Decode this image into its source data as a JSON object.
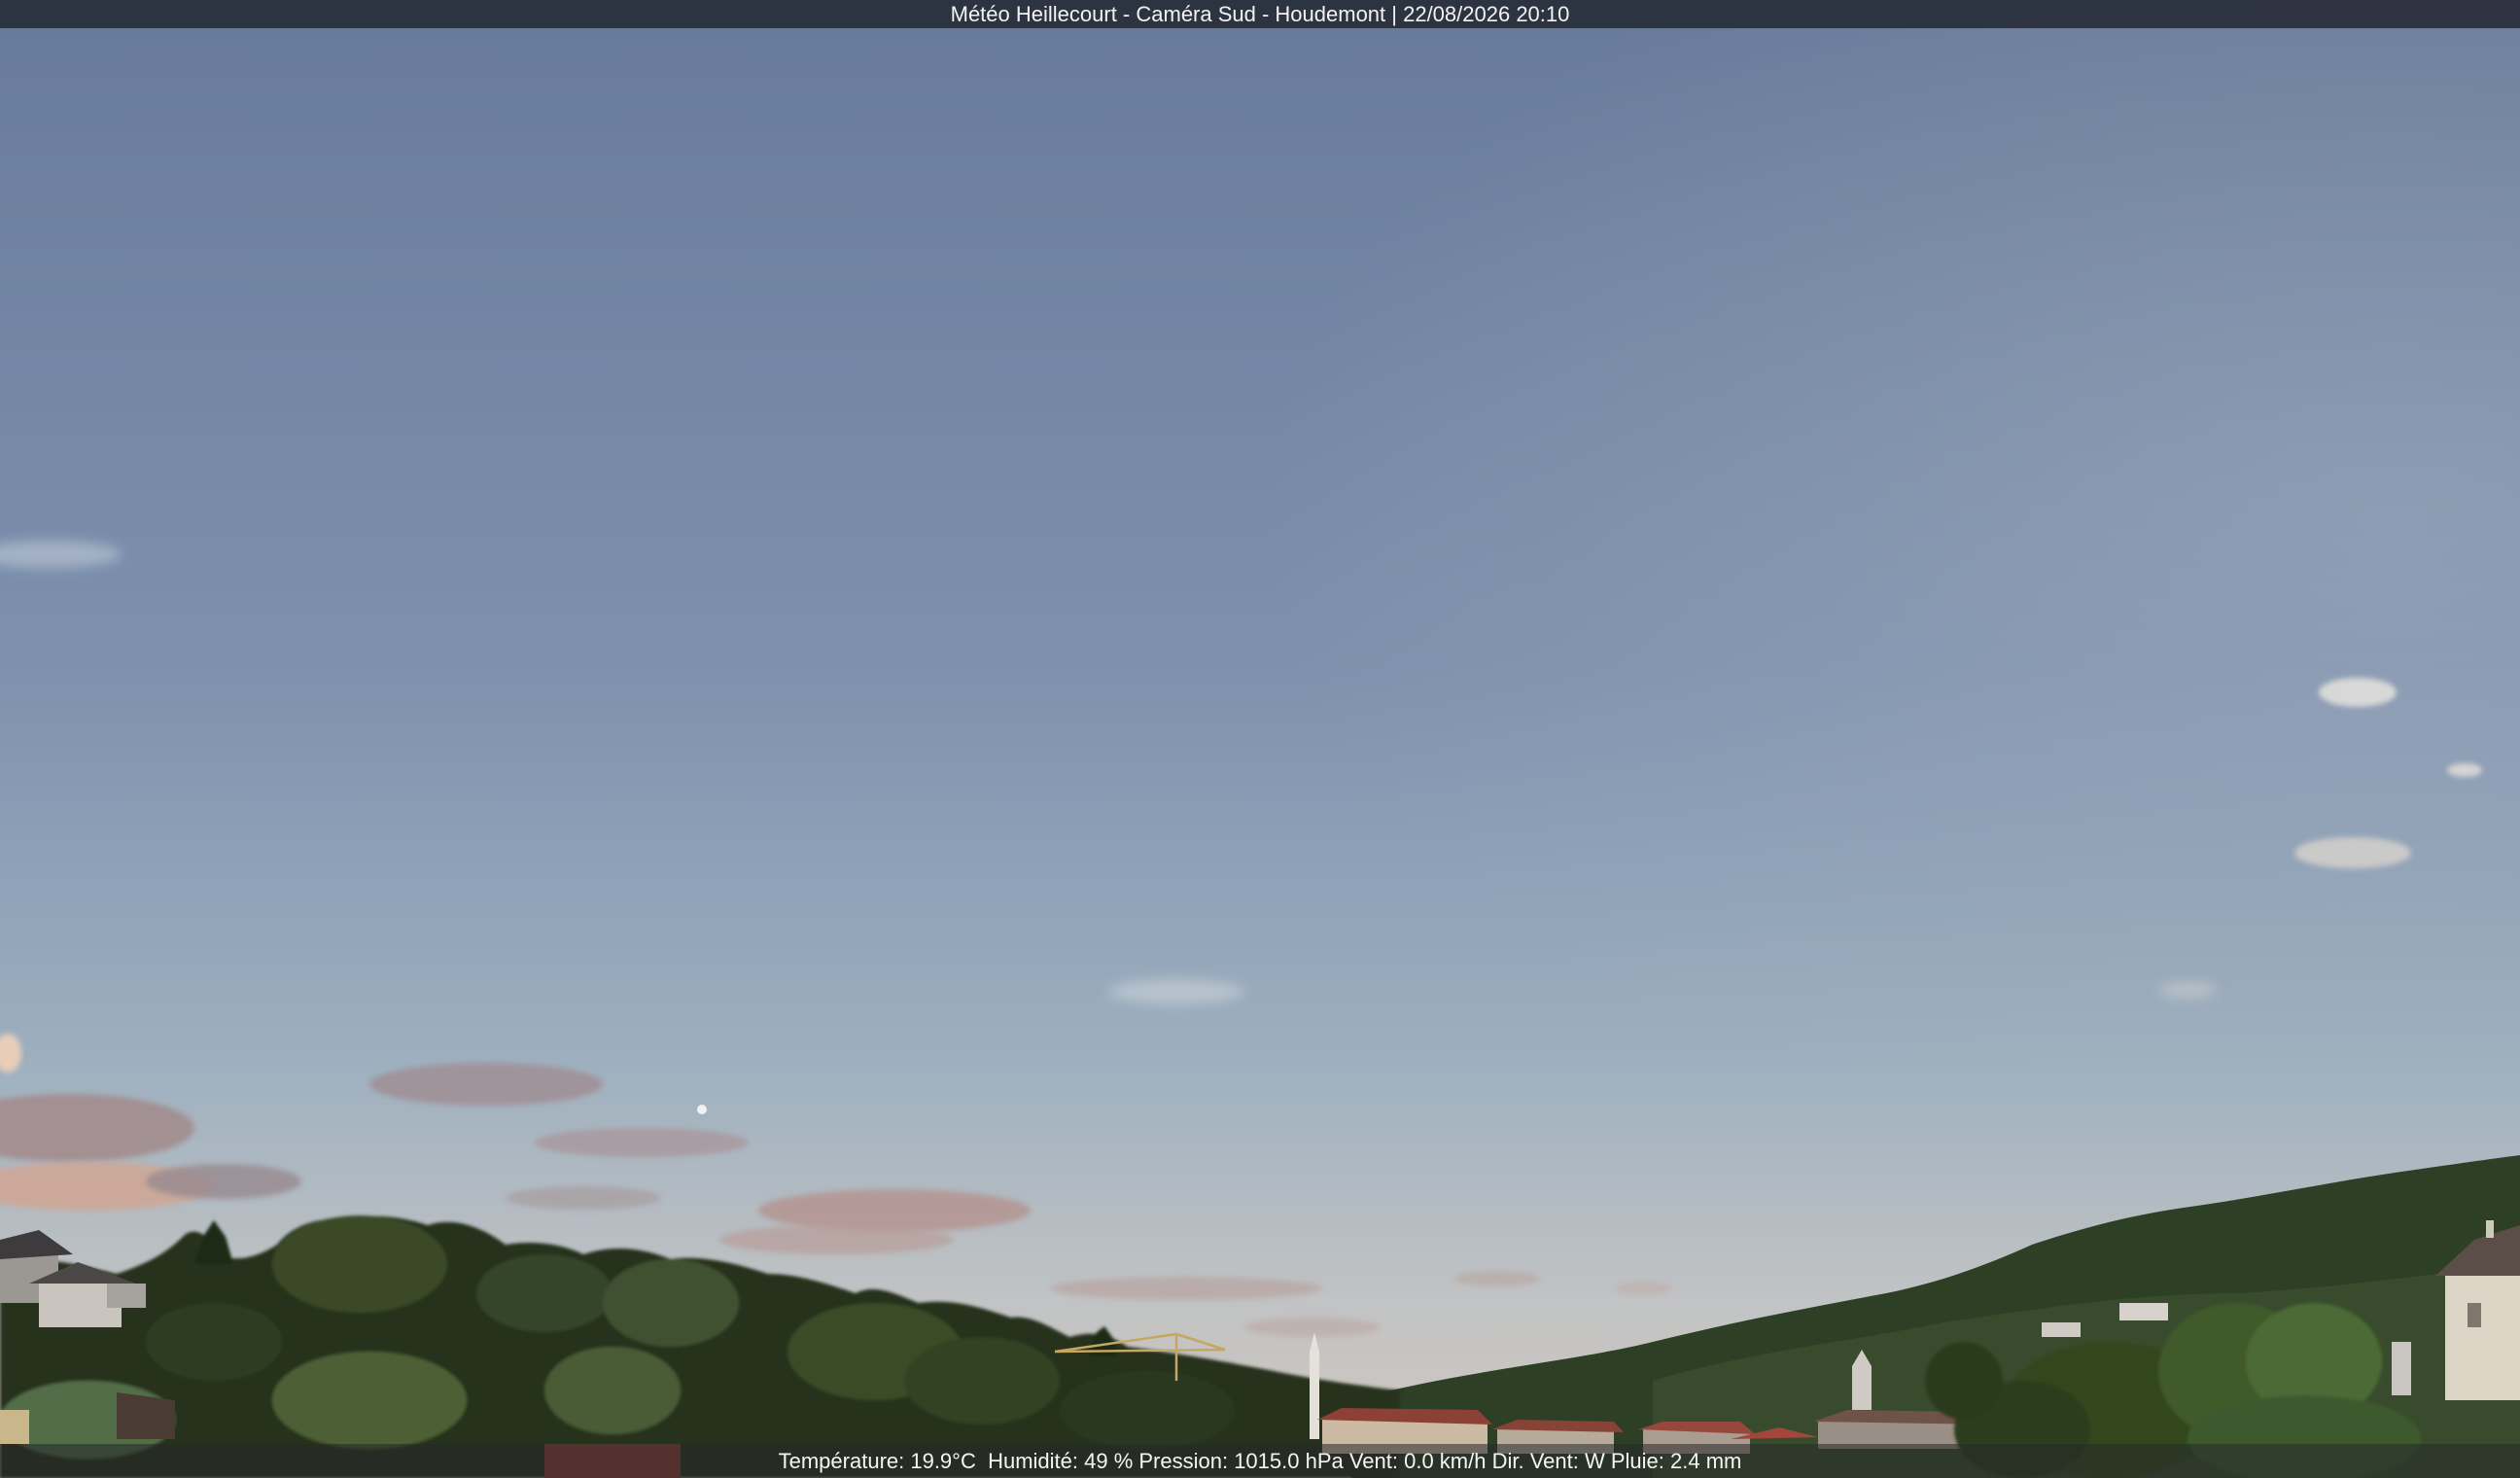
{
  "camera": {
    "title": "Météo Heillecourt - Caméra Sud - Houdemont | 22/08/2026 20:10"
  },
  "readout": {
    "text": "Température: 19.9°C  Humidité: 49 % Pression: 1015.0 hPa Vent: 0.0 km/h Dir. Vent: W Pluie: 2.4 mm"
  },
  "scene": {
    "sky_top_color": "#677a9a",
    "sky_mid_color": "#8aa0b6",
    "sky_horizon_color": "#c7c2bc",
    "cloud_color": "#b49896",
    "foliage_color": "#2f3f22",
    "roof_color": "#8a3e32"
  }
}
